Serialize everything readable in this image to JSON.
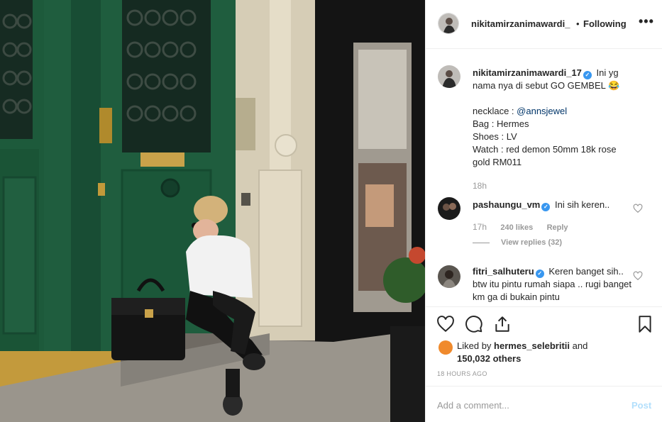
{
  "post": {
    "photo_alt": "woman sitting on step in front of green door",
    "username": "nikitamirzanimawardi_",
    "separator": "•",
    "follow_status": "Following",
    "more": "•••"
  },
  "caption": {
    "username": "nikitamirzanimawardi_17",
    "line1": "Ini yg nama nya di sebut GO GEMBEL 😂",
    "necklace_label": "necklace : ",
    "necklace_mention": "@annsjewel",
    "bag": "Bag : Hermes",
    "shoes": "Shoes : LV",
    "watch": "Watch : red demon 50mm 18k rose gold RM011",
    "time": "18h"
  },
  "comments": [
    {
      "username": "pashaungu_vm",
      "text": "Ini sih keren..",
      "time": "17h",
      "likes": "240 likes",
      "reply": "Reply",
      "view_replies": "View replies (32)"
    },
    {
      "username": "fitri_salhuteru",
      "text": "Keren banget sih.. btw itu pintu rumah siapa .. rugi banget km ga di bukain pintu"
    }
  ],
  "likes": {
    "prefix": "Liked by ",
    "liker": "hermes_selebritii",
    "and": " and",
    "others": "150,032 others"
  },
  "timestamp": "18 HOURS AGO",
  "add_comment": {
    "placeholder": "Add a comment...",
    "post_label": "Post"
  },
  "colors": {
    "door_green": "#1f5a3c",
    "verified_blue": "#3897f0",
    "link_blue": "#003569",
    "post_disabled": "#b2dffc"
  }
}
